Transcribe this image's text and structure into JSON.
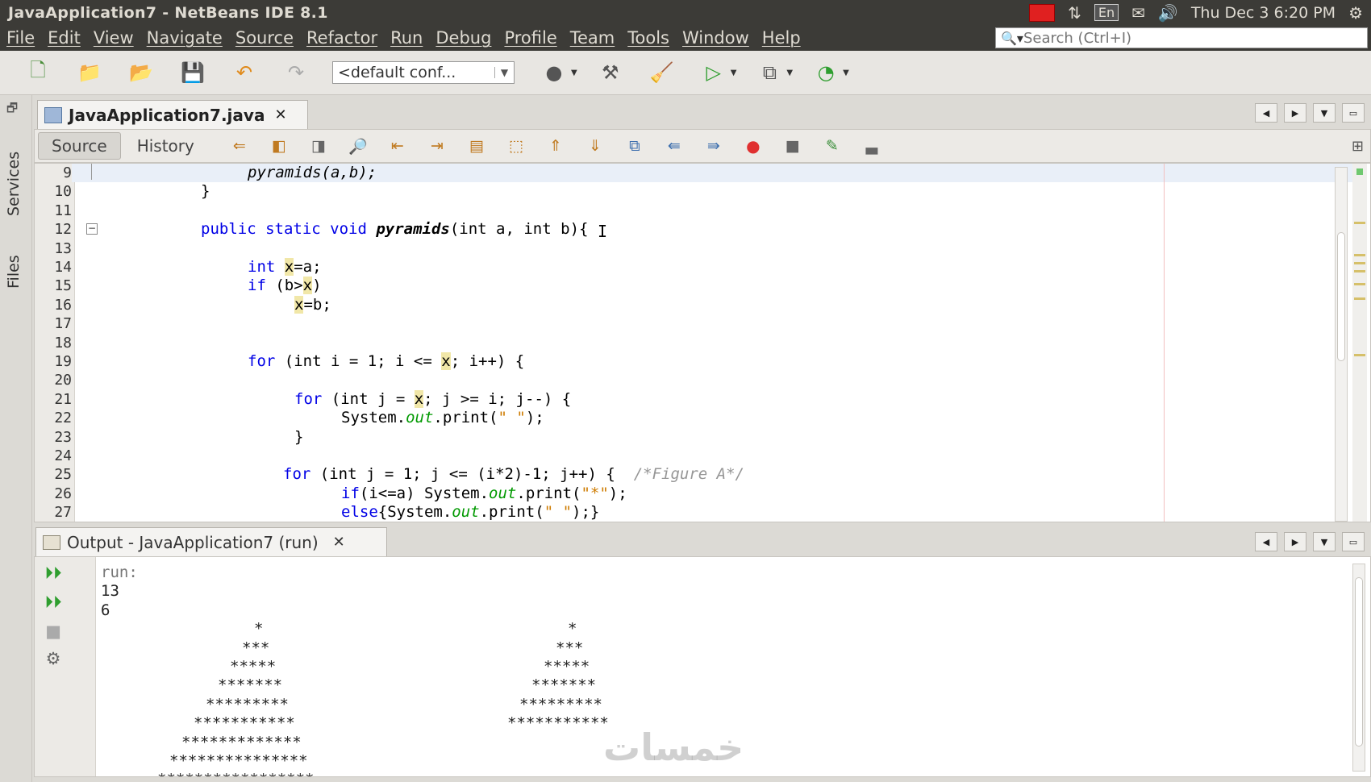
{
  "window": {
    "title": "JavaApplication7 - NetBeans IDE 8.1",
    "clock": "Thu Dec  3  6:20 PM",
    "keyboard": "En"
  },
  "menu": [
    "File",
    "Edit",
    "View",
    "Navigate",
    "Source",
    "Refactor",
    "Run",
    "Debug",
    "Profile",
    "Team",
    "Tools",
    "Window",
    "Help"
  ],
  "search": {
    "placeholder": "Search (Ctrl+I)"
  },
  "toolbar": {
    "config": "<default conf..."
  },
  "side_tabs": {
    "services": "Services",
    "files": "Files"
  },
  "editor": {
    "file_tab": "JavaApplication7.java",
    "source_tab": "Source",
    "history_tab": "History",
    "line_numbers": [
      "9",
      "10",
      "11",
      "12",
      "13",
      "14",
      "15",
      "16",
      "17",
      "18",
      "19",
      "20",
      "21",
      "22",
      "23",
      "24",
      "25",
      "26",
      "27"
    ],
    "code": {
      "l9": "pyramids(a,b);",
      "l10": "}",
      "l12_a": "public static void ",
      "l12_b": "pyramids",
      "l12_c": "(int a, int b){",
      "l14_a": "int ",
      "l14_b": "x",
      "l14_c": "=a;",
      "l15_a": "if ",
      "l15_b": "(b>",
      "l15_c": "x",
      "l15_d": ")",
      "l16_a": "x",
      "l16_b": "=b;",
      "l19_a": "for ",
      "l19_b": "(int i = 1; i <= ",
      "l19_c": "x",
      "l19_d": "; i++) {",
      "l21_a": "for ",
      "l21_b": "(int j = ",
      "l21_c": "x",
      "l21_d": "; j >= i; j--) {",
      "l22_a": "System.",
      "l22_b": "out",
      "l22_c": ".print(",
      "l22_d": "\" \"",
      "l22_e": ");",
      "l23": "}",
      "l25_a": "for ",
      "l25_b": "(int j = 1; j <= (i*2)-1; j++) {  ",
      "l25_c": "/*Figure A*/",
      "l26_a": "if",
      "l26_b": "(i<=a) System.",
      "l26_c": "out",
      "l26_d": ".print(",
      "l26_e": "\"*\"",
      "l26_f": ");",
      "l27_a": "else",
      "l27_b": "{System.",
      "l27_c": "out",
      "l27_d": ".print(",
      "l27_e": "\" \"",
      "l27_f": ");}"
    }
  },
  "output": {
    "tab": "Output - JavaApplication7 (run)",
    "run_label": "run:",
    "input1": "13",
    "input2": "6",
    "pyramid_left": [
      "*",
      "***",
      "*****",
      "*******",
      "*********",
      "***********",
      "*************",
      "***************",
      "*****************"
    ],
    "pyramid_right": [
      "*",
      "***",
      "*****",
      "*******",
      "*********",
      "***********"
    ]
  },
  "watermark": "خمسات"
}
